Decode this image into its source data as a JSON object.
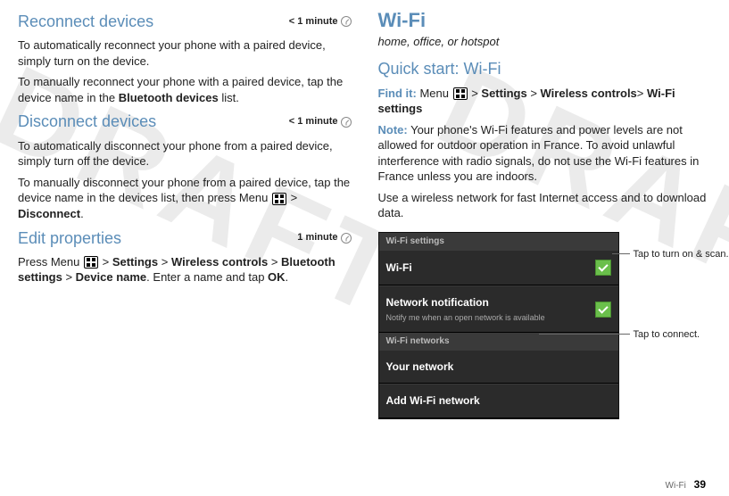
{
  "watermark": "DRAFT",
  "left": {
    "reconnect": {
      "heading": "Reconnect devices",
      "timing": "< 1 minute",
      "p1": "To automatically reconnect your phone with a paired device, simply turn on the device.",
      "p2a": "To manually reconnect your phone with a paired device, tap the device name in the ",
      "p2b": "Bluetooth devices",
      "p2c": " list."
    },
    "disconnect": {
      "heading": "Disconnect devices",
      "timing": "< 1 minute",
      "p1": "To automatically disconnect your phone from a paired device, simply turn off the device.",
      "p2a": "To manually disconnect your phone from a paired device, tap the device name in the devices list, then press Menu ",
      "p2b": " > ",
      "p2c": "Disconnect",
      "p2d": "."
    },
    "edit": {
      "heading": "Edit properties",
      "timing": "1 minute",
      "p1a": "Press Menu ",
      "p1b": " > ",
      "p1c": "Settings",
      "p1d": " > ",
      "p1e": "Wireless controls",
      "p1f": " > ",
      "p1g": "Bluetooth settings",
      "p1h": " > ",
      "p1i": "Device name",
      "p1j": ". Enter a name and tap ",
      "p1k": "OK",
      "p1l": "."
    }
  },
  "right": {
    "title": "Wi-Fi",
    "subtitle": "home, office, or hotspot",
    "quickstart": "Quick start: Wi-Fi",
    "findit_label": "Find it:",
    "findit_a": " Menu ",
    "findit_b": " > ",
    "findit_c": "Settings",
    "findit_d": " > ",
    "findit_e": "Wireless controls",
    "findit_f": "> ",
    "findit_g": "Wi-Fi settings",
    "note_label": "Note:",
    "note_text": " Your phone's Wi-Fi features and power levels are not allowed for outdoor operation in France. To avoid unlawful interference with radio signals, do not use the Wi-Fi features in France unless you are indoors.",
    "p2": "Use a wireless network for fast Internet access and to download data.",
    "phone": {
      "header": "Wi-Fi settings",
      "row1": "Wi-Fi",
      "row2_title": "Network notification",
      "row2_sub": "Notify me when an open network is available",
      "sub": "Wi-Fi networks",
      "row3": "Your network",
      "row4": "Add Wi-Fi network"
    },
    "callout1": "Tap to turn on & scan.",
    "callout2": "Tap to connect."
  },
  "footer": {
    "section": "Wi-Fi",
    "page": "39"
  }
}
